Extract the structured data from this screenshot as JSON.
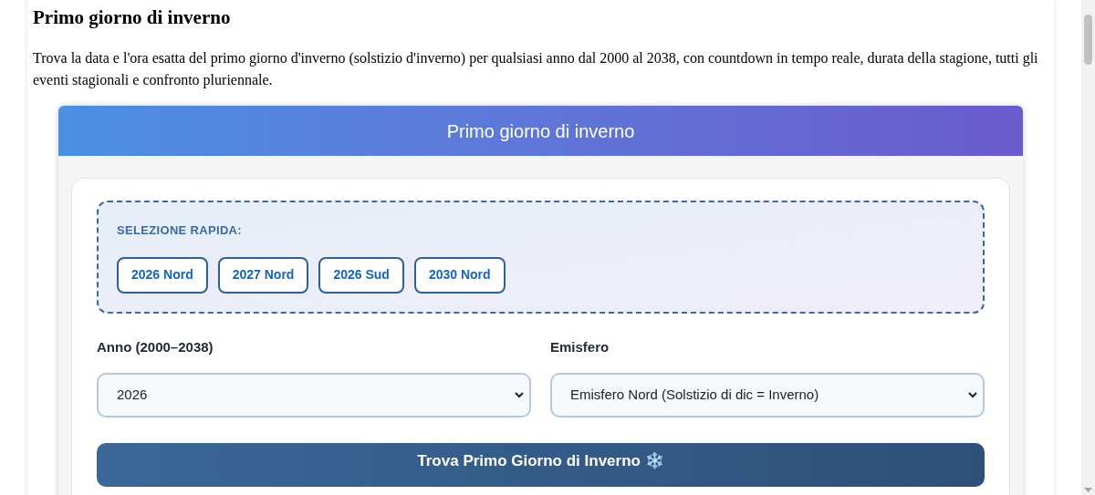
{
  "page": {
    "title": "Primo giorno di inverno",
    "intro": "Trova la data e l'ora esatta del primo giorno d'inverno (solstizio d'inverno) per qualsiasi anno dal 2000 al 2038, con countdown in tempo reale, durata della stagione, tutti gli eventi stagionali e confronto pluriennale."
  },
  "widget": {
    "header": "Primo giorno di inverno",
    "quick_select": {
      "label": "SELEZIONE RAPIDA:",
      "buttons": [
        "2026 Nord",
        "2027 Nord",
        "2026 Sud",
        "2030 Nord"
      ]
    },
    "fields": [
      {
        "label": "Anno (2000–2038)",
        "value": "2026"
      },
      {
        "label": "Emisfero",
        "value": "Emisfero Nord (Solstizio di dic = Inverno)"
      }
    ],
    "submit": "Trova Primo Giorno di Inverno ❄️"
  }
}
